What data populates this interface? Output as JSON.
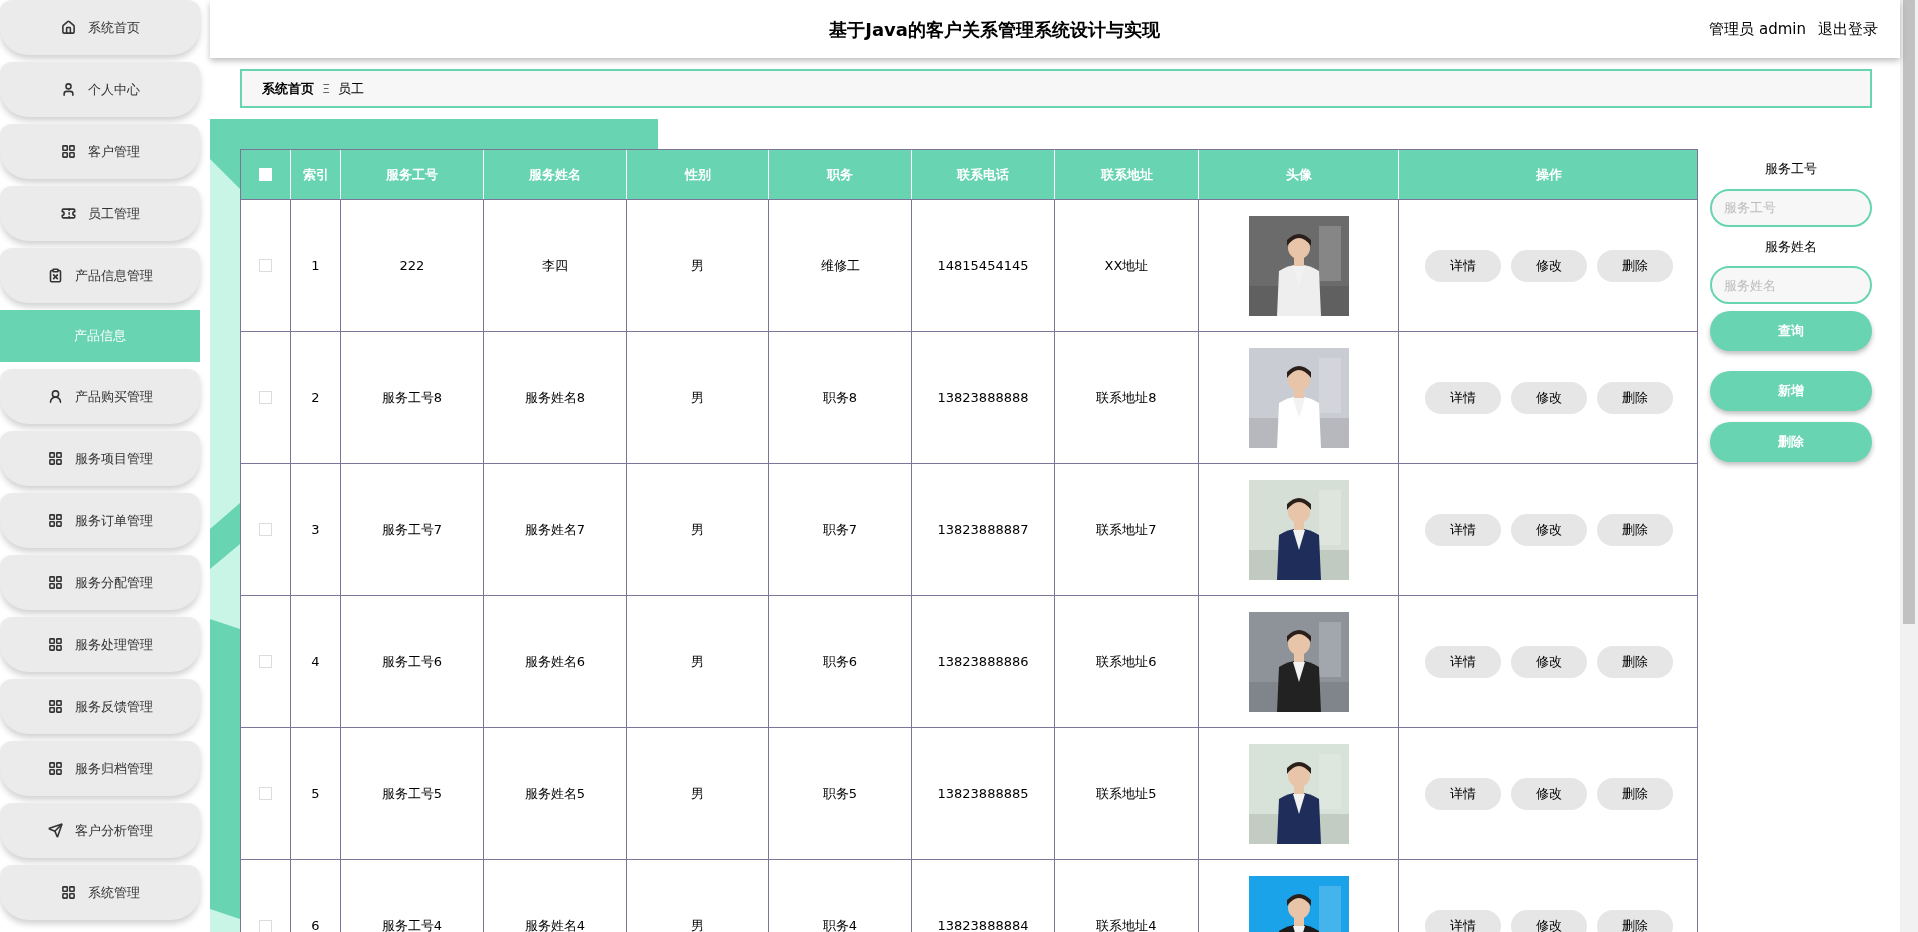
{
  "sidebar": {
    "items": [
      {
        "label": "系统首页",
        "selected": false
      },
      {
        "label": "个人中心",
        "selected": false
      },
      {
        "label": "客户管理",
        "selected": false
      },
      {
        "label": "员工管理",
        "selected": false
      },
      {
        "label": "产品信息管理",
        "selected": false,
        "children": [
          {
            "label": "产品信息",
            "selected": true
          }
        ]
      },
      {
        "label": "产品购买管理",
        "selected": false
      },
      {
        "label": "服务项目管理",
        "selected": false
      },
      {
        "label": "服务订单管理",
        "selected": false
      },
      {
        "label": "服务分配管理",
        "selected": false
      },
      {
        "label": "服务处理管理",
        "selected": false
      },
      {
        "label": "服务反馈管理",
        "selected": false
      },
      {
        "label": "服务归档管理",
        "selected": false
      },
      {
        "label": "客户分析管理",
        "selected": false
      },
      {
        "label": "系统管理",
        "selected": false
      }
    ]
  },
  "header": {
    "title": "基于Java的客户关系管理系统设计与实现",
    "user": "管理员 admin",
    "logout": "退出登录"
  },
  "breadcrumb": {
    "home": "系统首页",
    "separator": "Ξ",
    "current": "员工"
  },
  "table": {
    "header_checkbox": {
      "checked": false
    },
    "columns": [
      "索引",
      "服务工号",
      "服务姓名",
      "性别",
      "职务",
      "联系电话",
      "联系地址",
      "头像",
      "操作"
    ],
    "rows": [
      {
        "checked": false,
        "cells": [
          "1",
          "222",
          "李四",
          "男",
          "维修工",
          "14815454145",
          "XX地址"
        ],
        "actions": [
          "详情",
          "修改",
          "删除"
        ]
      },
      {
        "checked": false,
        "cells": [
          "2",
          "服务工号8",
          "服务姓名8",
          "男",
          "职务8",
          "13823888888",
          "联系地址8"
        ],
        "actions": [
          "详情",
          "修改",
          "删除"
        ]
      },
      {
        "checked": false,
        "cells": [
          "3",
          "服务工号7",
          "服务姓名7",
          "男",
          "职务7",
          "13823888887",
          "联系地址7"
        ],
        "actions": [
          "详情",
          "修改",
          "删除"
        ]
      },
      {
        "checked": false,
        "cells": [
          "4",
          "服务工号6",
          "服务姓名6",
          "男",
          "职务6",
          "13823888886",
          "联系地址6"
        ],
        "actions": [
          "详情",
          "修改",
          "删除"
        ]
      },
      {
        "checked": false,
        "cells": [
          "5",
          "服务工号5",
          "服务姓名5",
          "男",
          "职务5",
          "13823888885",
          "联系地址5"
        ],
        "actions": [
          "详情",
          "修改",
          "删除"
        ]
      },
      {
        "checked": false,
        "cells": [
          "6",
          "服务工号4",
          "服务姓名4",
          "男",
          "职务4",
          "13823888884",
          "联系地址4"
        ],
        "actions": [
          "详情",
          "修改",
          "删除"
        ]
      }
    ]
  },
  "search": {
    "fields": [
      {
        "label": "服务工号",
        "placeholder": "服务工号"
      },
      {
        "label": "服务姓名",
        "placeholder": "服务姓名"
      }
    ],
    "submit": "查询"
  },
  "actions": [
    "新增",
    "删除"
  ]
}
